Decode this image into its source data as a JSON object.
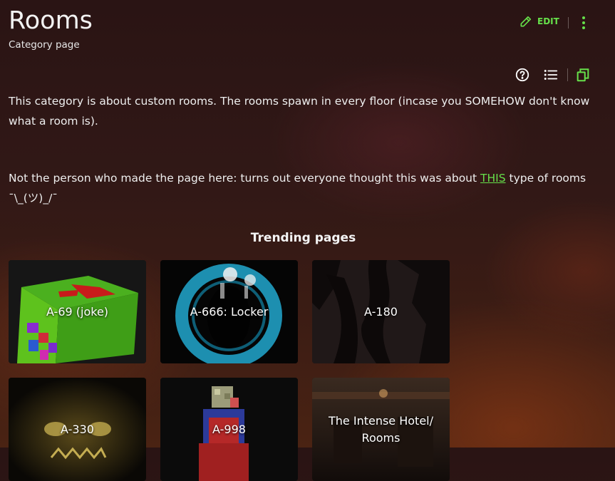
{
  "page": {
    "title": "Rooms",
    "subtitle": "Category page",
    "edit_label": "EDIT"
  },
  "content": {
    "para1": "This category is about custom rooms. The rooms spawn in every floor (incase you SOMEHOW don't know what a room is).",
    "para2_before": "Not the person who made the page here: turns out everyone thought this was about ",
    "para2_link": "THIS",
    "para2_after": " type of rooms",
    "shrug": "¯\\_(ツ)_/¯"
  },
  "trending": {
    "title": "Trending pages",
    "cards": [
      {
        "label": "A-69 (joke)"
      },
      {
        "label": "A-666: Locker"
      },
      {
        "label": "A-180"
      },
      {
        "label": "A-330"
      },
      {
        "label": "A-998"
      },
      {
        "label": "The Intense Hotel/ Rooms"
      }
    ]
  },
  "icons": {
    "edit": "pencil-icon",
    "more": "more-vertical-icon",
    "help": "help-circle-icon",
    "toc": "list-icon",
    "copy": "copy-icon"
  },
  "colors": {
    "accent": "#66e04a",
    "text": "#eeeeee"
  }
}
